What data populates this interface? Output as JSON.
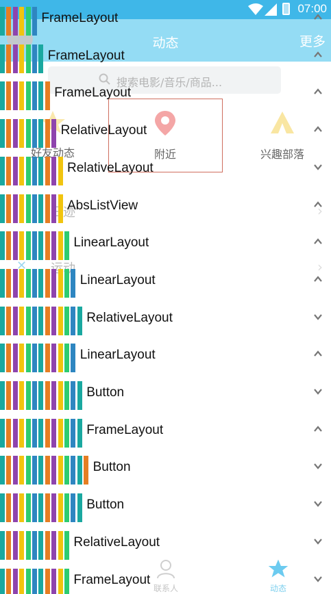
{
  "status_bar": {
    "time": "07:00"
  },
  "header": {
    "title": "动态",
    "more": "更多"
  },
  "search": {
    "placeholder": "搜索电影/音乐/商品..."
  },
  "features": [
    {
      "label": "好友动态",
      "icon": "star-icon"
    },
    {
      "label": "附近",
      "icon": "location-pin-icon"
    },
    {
      "label": "兴趣部落",
      "icon": "tribe-icon"
    }
  ],
  "list_items": [
    {
      "label": "日迹"
    },
    {
      "label": "运动"
    }
  ],
  "bottom_nav": {
    "contacts": "联系人",
    "dynamic": "动态"
  },
  "hierarchy": [
    {
      "name": "FrameLayout",
      "depth": 6,
      "chevron": "up"
    },
    {
      "name": "FrameLayout",
      "depth": 7,
      "chevron": "up"
    },
    {
      "name": "FrameLayout",
      "depth": 8,
      "chevron": "up"
    },
    {
      "name": "RelativeLayout",
      "depth": 9,
      "chevron": "up"
    },
    {
      "name": "RelativeLayout",
      "depth": 10,
      "chevron": "down"
    },
    {
      "name": "AbsListView",
      "depth": 10,
      "chevron": "up"
    },
    {
      "name": "LinearLayout",
      "depth": 11,
      "chevron": "up"
    },
    {
      "name": "LinearLayout",
      "depth": 12,
      "chevron": "up"
    },
    {
      "name": "RelativeLayout",
      "depth": 13,
      "chevron": "down"
    },
    {
      "name": "LinearLayout",
      "depth": 12,
      "chevron": "up"
    },
    {
      "name": "Button",
      "depth": 13,
      "chevron": "down"
    },
    {
      "name": "FrameLayout",
      "depth": 13,
      "chevron": "up"
    },
    {
      "name": "Button",
      "depth": 14,
      "chevron": "down"
    },
    {
      "name": "Button",
      "depth": 13,
      "chevron": "down"
    },
    {
      "name": "RelativeLayout",
      "depth": 11,
      "chevron": "down"
    },
    {
      "name": "FrameLayout",
      "depth": 11,
      "chevron": "down"
    }
  ],
  "bar_colors": [
    "#1aa8a0",
    "#e67e22",
    "#8e44ad",
    "#f1c40f",
    "#2ecc71",
    "#2e86c1"
  ],
  "accent": "#3fb7e8"
}
